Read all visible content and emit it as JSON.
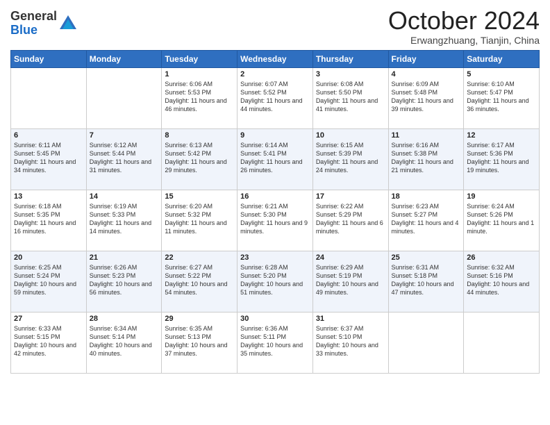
{
  "header": {
    "logo_general": "General",
    "logo_blue": "Blue",
    "month_title": "October 2024",
    "location": "Erwangzhuang, Tianjin, China"
  },
  "days_of_week": [
    "Sunday",
    "Monday",
    "Tuesday",
    "Wednesday",
    "Thursday",
    "Friday",
    "Saturday"
  ],
  "weeks": [
    [
      {
        "day": "",
        "info": ""
      },
      {
        "day": "",
        "info": ""
      },
      {
        "day": "1",
        "info": "Sunrise: 6:06 AM\nSunset: 5:53 PM\nDaylight: 11 hours and 46 minutes."
      },
      {
        "day": "2",
        "info": "Sunrise: 6:07 AM\nSunset: 5:52 PM\nDaylight: 11 hours and 44 minutes."
      },
      {
        "day": "3",
        "info": "Sunrise: 6:08 AM\nSunset: 5:50 PM\nDaylight: 11 hours and 41 minutes."
      },
      {
        "day": "4",
        "info": "Sunrise: 6:09 AM\nSunset: 5:48 PM\nDaylight: 11 hours and 39 minutes."
      },
      {
        "day": "5",
        "info": "Sunrise: 6:10 AM\nSunset: 5:47 PM\nDaylight: 11 hours and 36 minutes."
      }
    ],
    [
      {
        "day": "6",
        "info": "Sunrise: 6:11 AM\nSunset: 5:45 PM\nDaylight: 11 hours and 34 minutes."
      },
      {
        "day": "7",
        "info": "Sunrise: 6:12 AM\nSunset: 5:44 PM\nDaylight: 11 hours and 31 minutes."
      },
      {
        "day": "8",
        "info": "Sunrise: 6:13 AM\nSunset: 5:42 PM\nDaylight: 11 hours and 29 minutes."
      },
      {
        "day": "9",
        "info": "Sunrise: 6:14 AM\nSunset: 5:41 PM\nDaylight: 11 hours and 26 minutes."
      },
      {
        "day": "10",
        "info": "Sunrise: 6:15 AM\nSunset: 5:39 PM\nDaylight: 11 hours and 24 minutes."
      },
      {
        "day": "11",
        "info": "Sunrise: 6:16 AM\nSunset: 5:38 PM\nDaylight: 11 hours and 21 minutes."
      },
      {
        "day": "12",
        "info": "Sunrise: 6:17 AM\nSunset: 5:36 PM\nDaylight: 11 hours and 19 minutes."
      }
    ],
    [
      {
        "day": "13",
        "info": "Sunrise: 6:18 AM\nSunset: 5:35 PM\nDaylight: 11 hours and 16 minutes."
      },
      {
        "day": "14",
        "info": "Sunrise: 6:19 AM\nSunset: 5:33 PM\nDaylight: 11 hours and 14 minutes."
      },
      {
        "day": "15",
        "info": "Sunrise: 6:20 AM\nSunset: 5:32 PM\nDaylight: 11 hours and 11 minutes."
      },
      {
        "day": "16",
        "info": "Sunrise: 6:21 AM\nSunset: 5:30 PM\nDaylight: 11 hours and 9 minutes."
      },
      {
        "day": "17",
        "info": "Sunrise: 6:22 AM\nSunset: 5:29 PM\nDaylight: 11 hours and 6 minutes."
      },
      {
        "day": "18",
        "info": "Sunrise: 6:23 AM\nSunset: 5:27 PM\nDaylight: 11 hours and 4 minutes."
      },
      {
        "day": "19",
        "info": "Sunrise: 6:24 AM\nSunset: 5:26 PM\nDaylight: 11 hours and 1 minute."
      }
    ],
    [
      {
        "day": "20",
        "info": "Sunrise: 6:25 AM\nSunset: 5:24 PM\nDaylight: 10 hours and 59 minutes."
      },
      {
        "day": "21",
        "info": "Sunrise: 6:26 AM\nSunset: 5:23 PM\nDaylight: 10 hours and 56 minutes."
      },
      {
        "day": "22",
        "info": "Sunrise: 6:27 AM\nSunset: 5:22 PM\nDaylight: 10 hours and 54 minutes."
      },
      {
        "day": "23",
        "info": "Sunrise: 6:28 AM\nSunset: 5:20 PM\nDaylight: 10 hours and 51 minutes."
      },
      {
        "day": "24",
        "info": "Sunrise: 6:29 AM\nSunset: 5:19 PM\nDaylight: 10 hours and 49 minutes."
      },
      {
        "day": "25",
        "info": "Sunrise: 6:31 AM\nSunset: 5:18 PM\nDaylight: 10 hours and 47 minutes."
      },
      {
        "day": "26",
        "info": "Sunrise: 6:32 AM\nSunset: 5:16 PM\nDaylight: 10 hours and 44 minutes."
      }
    ],
    [
      {
        "day": "27",
        "info": "Sunrise: 6:33 AM\nSunset: 5:15 PM\nDaylight: 10 hours and 42 minutes."
      },
      {
        "day": "28",
        "info": "Sunrise: 6:34 AM\nSunset: 5:14 PM\nDaylight: 10 hours and 40 minutes."
      },
      {
        "day": "29",
        "info": "Sunrise: 6:35 AM\nSunset: 5:13 PM\nDaylight: 10 hours and 37 minutes."
      },
      {
        "day": "30",
        "info": "Sunrise: 6:36 AM\nSunset: 5:11 PM\nDaylight: 10 hours and 35 minutes."
      },
      {
        "day": "31",
        "info": "Sunrise: 6:37 AM\nSunset: 5:10 PM\nDaylight: 10 hours and 33 minutes."
      },
      {
        "day": "",
        "info": ""
      },
      {
        "day": "",
        "info": ""
      }
    ]
  ]
}
